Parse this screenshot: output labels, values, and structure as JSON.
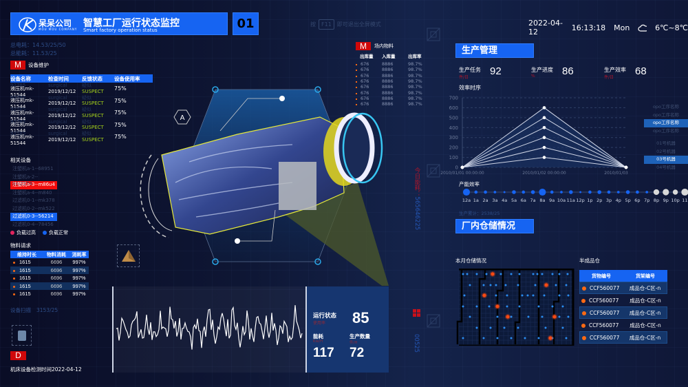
{
  "header": {
    "company": "呆呆公司",
    "company_en": "MOU MOU COMPANY",
    "title": "智慧工厂运行状态监控",
    "subtitle": "Smart factory operation status",
    "screen_no": "01",
    "hint_pre": "按",
    "hint_key": "F11",
    "hint_post": "即可退出全屏模式"
  },
  "datetime": {
    "date": "2022-04-12",
    "time": "16:13:18",
    "weekday": "Mon",
    "weather_icon": "cloud-icon",
    "temp": "6℃~8℃"
  },
  "totals": {
    "power": "总电耗：14.53/25/50",
    "energy": "总能耗：11.53/25"
  },
  "maintenance": {
    "badge": "M",
    "title": "设备维护",
    "headers": [
      "设备名称",
      "检查时间",
      "反馈状态",
      "设备使用率"
    ],
    "rows": [
      {
        "ghost_id": "92785",
        "ghost_type": "surgical",
        "ghost_state": "疑似",
        "name": "液压机mk-51544",
        "date": "2019/12/12",
        "status": "SUSPECT",
        "rate": "75%"
      },
      {
        "ghost_id": "92785",
        "ghost_type": "surgical",
        "ghost_state": "疑似",
        "name": "液压机mk-51544",
        "date": "2019/12/12",
        "status": "SUSPECT",
        "rate": "75%"
      },
      {
        "ghost_id": "92785",
        "ghost_type": "surgical",
        "ghost_state": "疑似",
        "name": "液压机mk-51544",
        "date": "2019/12/12",
        "status": "SUSPECT",
        "rate": "75%"
      },
      {
        "ghost_id": "92785",
        "ghost_type": "surgical",
        "ghost_state": "疑似",
        "name": "液压机mk-51544",
        "date": "2019/12/12",
        "status": "SUSPECT",
        "rate": "75%"
      },
      {
        "ghost_id": "92785",
        "ghost_type": "surgical",
        "ghost_state": "疑似",
        "name": "液压机mk-51544",
        "date": "2019/12/12",
        "status": "SUSPECT",
        "rate": "75%"
      }
    ]
  },
  "related": {
    "title": "相关设备",
    "items": [
      {
        "label": "注塑机a-1--68951",
        "state": "none"
      },
      {
        "label": "注塑机a-2--mk2274",
        "state": "none"
      },
      {
        "label": "注塑机a-3--m86u4",
        "state": "overload"
      },
      {
        "label": "注塑机a-4--m840",
        "state": "none"
      },
      {
        "label": "过滤机0-1--mk378",
        "state": "none"
      },
      {
        "label": "过滤机0-2--mk522",
        "state": "none"
      },
      {
        "label": "过滤机0-3--56214",
        "state": "normal"
      },
      {
        "label": "过滤机0-4--78456",
        "state": "none"
      }
    ],
    "legend": [
      {
        "label": "负载过高",
        "color": "#e0245e"
      },
      {
        "label": "负载正常",
        "color": "#1664f2"
      }
    ]
  },
  "material": {
    "title": "物料请求",
    "headers": [
      "维持时长",
      "物料消耗",
      "消耗率"
    ],
    "rows": [
      [
        "1615",
        "6696",
        "997%"
      ],
      [
        "1615",
        "6696",
        "997%"
      ],
      [
        "1615",
        "6696",
        "997%"
      ],
      [
        "1615",
        "6696",
        "997%"
      ],
      [
        "1615",
        "6696",
        "997%"
      ]
    ]
  },
  "scan": {
    "label": "设备扫描",
    "value": "3153/25",
    "badge": "D",
    "check": "机床设备检测时间2022-04-12"
  },
  "center": {
    "marker": "A"
  },
  "inventory": {
    "badge": "M",
    "title": "场内物料",
    "headers": [
      "出库量",
      "入库量",
      "出库率"
    ],
    "rows": [
      [
        "676",
        "8886",
        "98.7%"
      ],
      [
        "676",
        "8886",
        "98.7%"
      ],
      [
        "676",
        "8886",
        "98.7%"
      ],
      [
        "676",
        "8886",
        "98.7%"
      ],
      [
        "676",
        "8886",
        "98.7%"
      ],
      [
        "676",
        "8886",
        "98.7%"
      ],
      [
        "676",
        "8886",
        "98.7%"
      ],
      [
        "676",
        "8886",
        "98.7%"
      ]
    ]
  },
  "runtime": {
    "status_label": "运行状态",
    "status_unit": "使用率",
    "status_value": "85",
    "energy_label": "能耗",
    "energy_unit": "Kw/H",
    "energy_value": "117",
    "output_label": "生产数量",
    "output_unit": "件/H",
    "output_value": "72"
  },
  "vertical": {
    "today_label": "今日能耗：",
    "today_value": "565646225",
    "code": "00525"
  },
  "production": {
    "title": "生产管理",
    "stats": [
      {
        "label": "生产任务",
        "unit": "件/日",
        "value": "92"
      },
      {
        "label": "生产进度",
        "unit": "%",
        "value": "86"
      },
      {
        "label": "生产效率",
        "unit": "件/日",
        "value": "68"
      }
    ],
    "chart_title": "效率时序",
    "process_list": [
      "opo工序名称",
      "opo工序名称",
      "opo工序名称",
      "opo工序名称"
    ],
    "process_selected": 2,
    "machine_list": [
      "01号机器",
      "02号机器",
      "03号机器",
      "04号机器"
    ],
    "machine_selected": 2,
    "capacity_title": "产能效率",
    "cumulative": "生产累计：2538/25"
  },
  "chart_data": {
    "type": "line",
    "ylim": [
      0,
      700
    ],
    "yticks": [
      0,
      100,
      200,
      300,
      400,
      500,
      600,
      700
    ],
    "x": [
      "2010/01/01 00:00:00",
      "2010/01/02 00:00:00",
      "2010/01/03 00:00:00"
    ],
    "grid": true,
    "series": [
      {
        "values": [
          0,
          100,
          0
        ]
      },
      {
        "values": [
          0,
          200,
          0
        ]
      },
      {
        "values": [
          0,
          300,
          0
        ]
      },
      {
        "values": [
          0,
          400,
          0
        ]
      },
      {
        "values": [
          0,
          500,
          0
        ]
      },
      {
        "values": [
          0,
          600,
          0
        ]
      }
    ]
  },
  "capacity": {
    "hours": [
      "12a",
      "1a",
      "2a",
      "3a",
      "4a",
      "5a",
      "6a",
      "7a",
      "8a",
      "9a",
      "10a",
      "11a",
      "12p",
      "1p",
      "2p",
      "3p",
      "4p",
      "5p",
      "6p",
      "7p",
      "8p",
      "9p",
      "10p",
      "11"
    ],
    "levels": [
      9,
      3,
      3,
      2,
      1,
      4,
      3,
      4,
      9,
      3,
      2,
      4,
      1,
      3,
      4,
      3,
      2,
      4,
      3,
      2,
      7,
      8,
      6,
      9
    ],
    "colors": [
      "#1664f2",
      "#1664f2",
      "#1664f2",
      "#1664f2",
      "#1664f2",
      "#1664f2",
      "#1664f2",
      "#1664f2",
      "#1664f2",
      "#1664f2",
      "#1664f2",
      "#1664f2",
      "#1664f2",
      "#1664f2",
      "#1664f2",
      "#1664f2",
      "#1664f2",
      "#1664f2",
      "#1664f2",
      "#1664f2",
      "#d8d8d8",
      "#d8d8d8",
      "#d8d8d8",
      "#d8d8d8"
    ]
  },
  "warehouse": {
    "title": "厂内仓储情况",
    "monthly": "本月仓储情况",
    "semi": "半成品仓",
    "headers": [
      "货物编号",
      "货架编号"
    ],
    "rows": [
      [
        "CCF560077",
        "成品仓-C区-n"
      ],
      [
        "CCF560077",
        "成品仓-C区-n"
      ],
      [
        "CCF560077",
        "成品仓-C区-n"
      ],
      [
        "CCF560077",
        "成品仓-C区-n"
      ],
      [
        "CCF560077",
        "成品仓-C区-n"
      ]
    ]
  },
  "colors": {
    "accent": "#1664f2",
    "alert": "#d0080a",
    "suspect": "#a6d11a",
    "orange": "#ff6a13"
  }
}
